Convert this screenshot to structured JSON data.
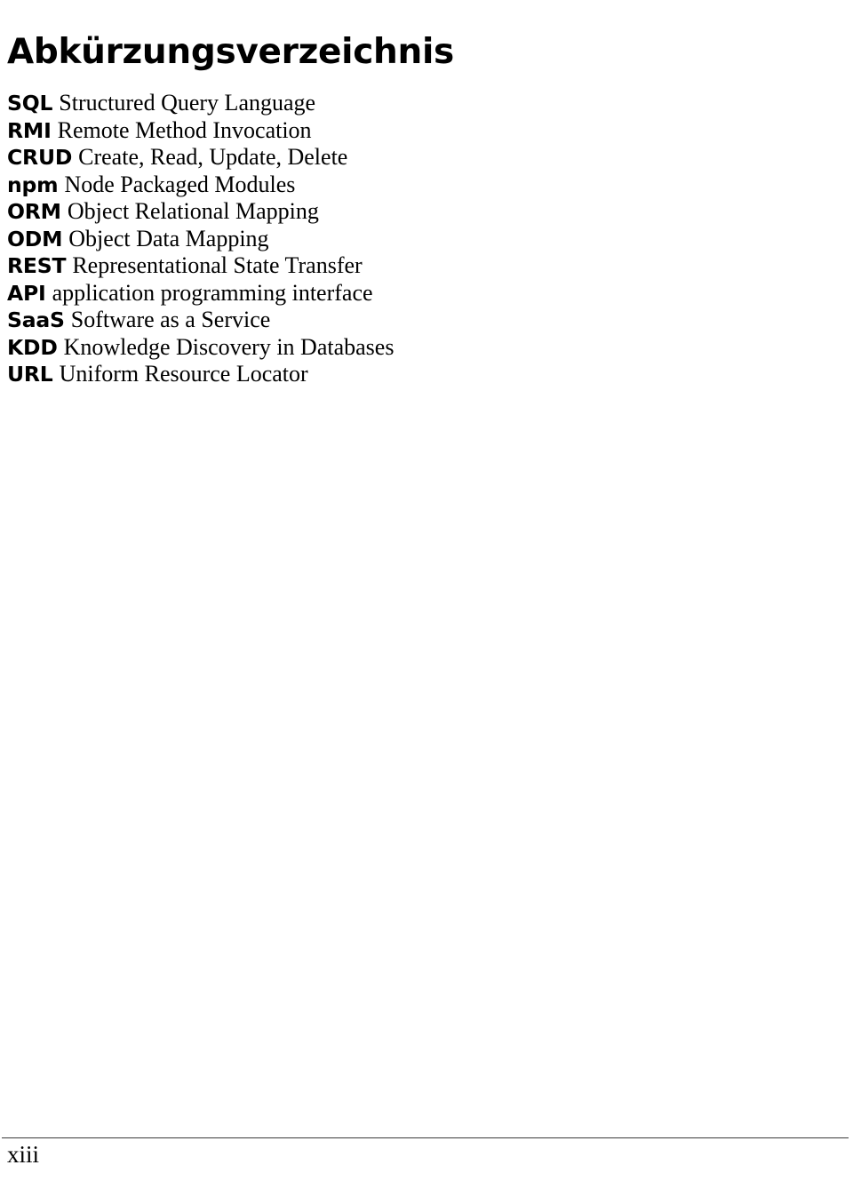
{
  "document": {
    "title": "Abkürzungsverzeichnis",
    "page_number": "xiii",
    "text_color": "#000000",
    "background_color": "#ffffff",
    "rule_color": "#3a3a3a"
  },
  "abbreviations": [
    {
      "term": "SQL",
      "definition": "Structured Query Language"
    },
    {
      "term": "RMI",
      "definition": "Remote Method Invocation"
    },
    {
      "term": "CRUD",
      "definition": "Create, Read, Update, Delete"
    },
    {
      "term": "npm",
      "definition": "Node Packaged Modules"
    },
    {
      "term": "ORM",
      "definition": "Object Relational Mapping"
    },
    {
      "term": "ODM",
      "definition": "Object Data Mapping"
    },
    {
      "term": "REST",
      "definition": "Representational State Transfer"
    },
    {
      "term": "API",
      "definition": "application programming interface"
    },
    {
      "term": "SaaS",
      "definition": "Software as a Service"
    },
    {
      "term": "KDD",
      "definition": "Knowledge Discovery in Databases"
    },
    {
      "term": "URL",
      "definition": "Uniform Resource Locator"
    }
  ]
}
